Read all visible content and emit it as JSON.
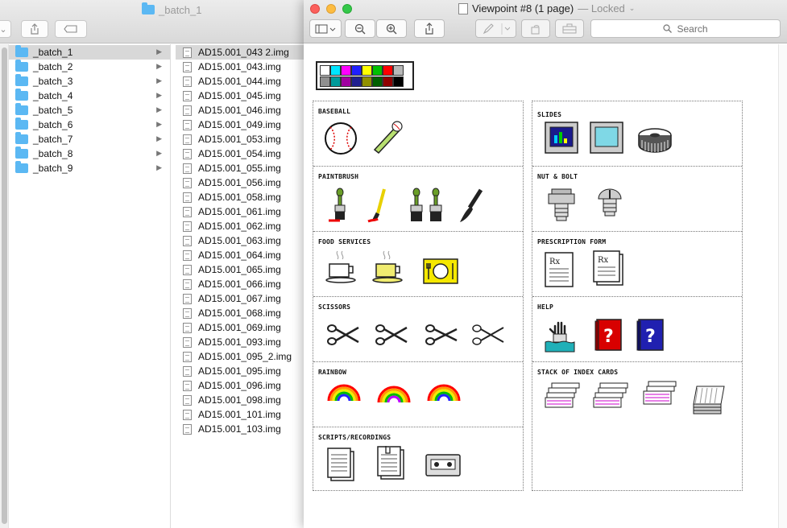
{
  "finder": {
    "title": "_batch_1",
    "folders": [
      "_batch_1",
      "_batch_2",
      "_batch_3",
      "_batch_4",
      "_batch_5",
      "_batch_6",
      "_batch_7",
      "_batch_8",
      "_batch_9"
    ],
    "files": [
      "AD15.001_043 2.img",
      "AD15.001_043.img",
      "AD15.001_044.img",
      "AD15.001_045.img",
      "AD15.001_046.img",
      "AD15.001_049.img",
      "AD15.001_053.img",
      "AD15.001_054.img",
      "AD15.001_055.img",
      "AD15.001_056.img",
      "AD15.001_058.img",
      "AD15.001_061.img",
      "AD15.001_062.img",
      "AD15.001_063.img",
      "AD15.001_064.img",
      "AD15.001_065.img",
      "AD15.001_066.img",
      "AD15.001_067.img",
      "AD15.001_068.img",
      "AD15.001_069.img",
      "AD15.001_093.img",
      "AD15.001_095_2.img",
      "AD15.001_095.img",
      "AD15.001_096.img",
      "AD15.001_098.img",
      "AD15.001_101.img",
      "AD15.001_103.img"
    ]
  },
  "preview": {
    "title": "Viewpoint #8 (1 page)",
    "status": "— Locked",
    "search_placeholder": "Search"
  },
  "palette": {
    "row1": [
      "#ffffff",
      "#00e5ff",
      "#ff00ff",
      "#2020ff",
      "#ffff00",
      "#00c000",
      "#ff0000",
      "#b8b8b8"
    ],
    "row2": [
      "#909090",
      "#009a9a",
      "#a000a0",
      "#202090",
      "#909000",
      "#006000",
      "#900000",
      "#000000"
    ]
  },
  "sections_left": [
    {
      "label": "BASEBALL"
    },
    {
      "label": "PAINTBRUSH"
    },
    {
      "label": "FOOD SERVICES"
    },
    {
      "label": "SCISSORS"
    },
    {
      "label": "RAINBOW"
    },
    {
      "label": "SCRIPTS/RECORDINGS"
    }
  ],
  "sections_right": [
    {
      "label": "SLIDES"
    },
    {
      "label": "NUT & BOLT"
    },
    {
      "label": "PRESCRIPTION FORM"
    },
    {
      "label": "HELP"
    },
    {
      "label": "STACK OF INDEX CARDS"
    }
  ],
  "icon_text": {
    "rx": "Rx",
    "help_mark": "?"
  },
  "colors": {
    "close": "#fc605c",
    "minimize": "#fdbc40",
    "zoom": "#34c84a",
    "folder": "#5bb8f3"
  }
}
